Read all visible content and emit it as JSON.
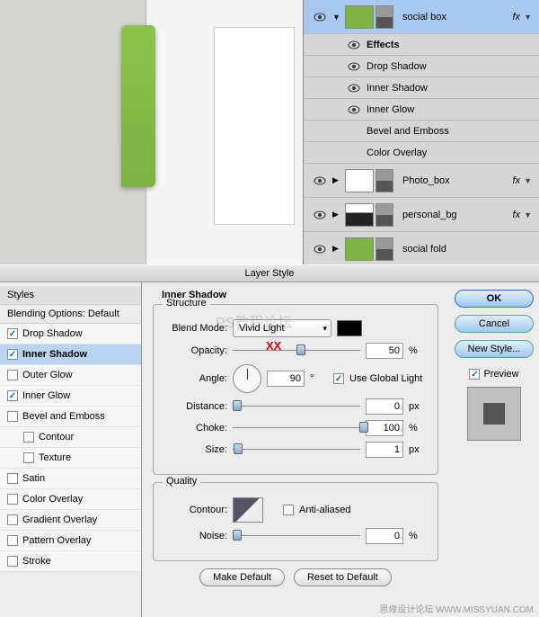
{
  "layers": {
    "items": [
      {
        "name": "social box",
        "fx": true,
        "selected": true,
        "expanded": true,
        "thumb": "green"
      },
      {
        "name": "Photo_box",
        "fx": true,
        "thumb": "white"
      },
      {
        "name": "personal_bg",
        "fx": true,
        "thumb": "dark"
      },
      {
        "name": "social fold",
        "fx": false,
        "thumb": "green"
      }
    ],
    "effects_label": "Effects",
    "effects": [
      {
        "name": "Drop Shadow",
        "visible": true
      },
      {
        "name": "Inner Shadow",
        "visible": true
      },
      {
        "name": "Inner Glow",
        "visible": true
      },
      {
        "name": "Bevel and Emboss",
        "visible": false
      },
      {
        "name": "Color Overlay",
        "visible": false
      }
    ],
    "fx_label": "fx"
  },
  "dialog": {
    "title": "Layer Style",
    "styles_head": "Styles",
    "blending_label": "Blending Options: Default",
    "items": [
      {
        "label": "Drop Shadow",
        "checked": true
      },
      {
        "label": "Inner Shadow",
        "checked": true,
        "selected": true
      },
      {
        "label": "Outer Glow",
        "checked": false
      },
      {
        "label": "Inner Glow",
        "checked": true
      },
      {
        "label": "Bevel and Emboss",
        "checked": false
      },
      {
        "label": "Contour",
        "checked": false,
        "indent": true
      },
      {
        "label": "Texture",
        "checked": false,
        "indent": true
      },
      {
        "label": "Satin",
        "checked": false
      },
      {
        "label": "Color Overlay",
        "checked": false
      },
      {
        "label": "Gradient Overlay",
        "checked": false
      },
      {
        "label": "Pattern Overlay",
        "checked": false
      },
      {
        "label": "Stroke",
        "checked": false
      }
    ],
    "panel_title": "Inner Shadow",
    "structure_label": "Structure",
    "blend_mode_label": "Blend Mode:",
    "blend_mode_value": "Vivid Light",
    "opacity_label": "Opacity:",
    "opacity_value": "50",
    "angle_label": "Angle:",
    "angle_value": "90",
    "angle_unit": "°",
    "global_light_label": "Use Global Light",
    "distance_label": "Distance:",
    "distance_value": "0",
    "choke_label": "Choke:",
    "choke_value": "100",
    "size_label": "Size:",
    "size_value": "1",
    "px_unit": "px",
    "pct_unit": "%",
    "quality_label": "Quality",
    "contour_label": "Contour:",
    "antialias_label": "Anti-aliased",
    "noise_label": "Noise:",
    "noise_value": "0",
    "make_default": "Make Default",
    "reset_default": "Reset to Default",
    "ok": "OK",
    "cancel": "Cancel",
    "new_style": "New Style...",
    "preview_label": "Preview",
    "xx": "XX"
  },
  "footer": "思缘设计论坛  WWW.MISSYUAN.COM",
  "watermark": "PS教程论坛"
}
